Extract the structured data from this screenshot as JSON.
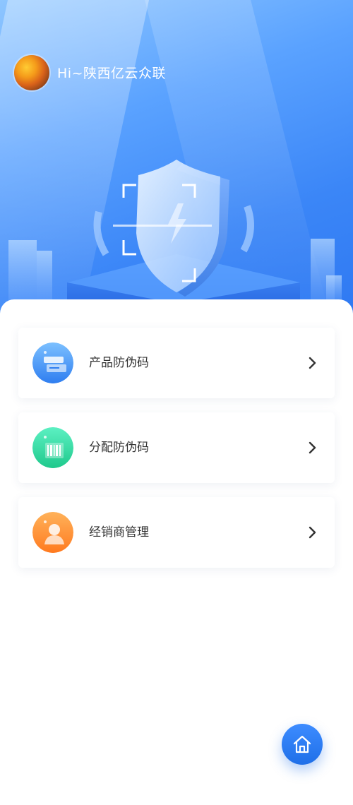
{
  "header": {
    "greeting": "Hi~陕西亿云众联"
  },
  "menu": [
    {
      "label": "产品防伪码",
      "icon": "product-code-icon"
    },
    {
      "label": "分配防伪码",
      "icon": "barcode-icon"
    },
    {
      "label": "经销商管理",
      "icon": "dealer-icon"
    }
  ],
  "colors": {
    "brand_blue": "#3b86f7",
    "icon_blue": "#4a8ff5",
    "icon_green": "#2fd39b",
    "icon_orange": "#ff8a2a"
  }
}
